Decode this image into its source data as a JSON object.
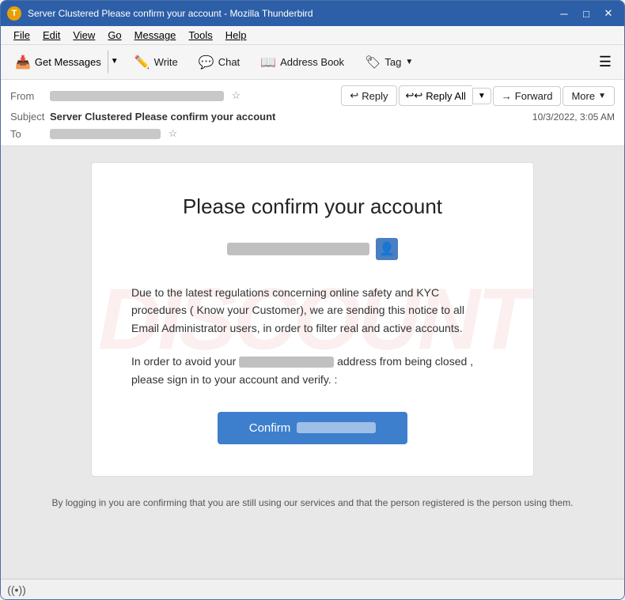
{
  "window": {
    "title": "Server Clustered Please confirm your account - Mozilla Thunderbird",
    "icon": "T"
  },
  "titlebar": {
    "minimize": "─",
    "maximize": "□",
    "close": "✕"
  },
  "menubar": {
    "items": [
      "File",
      "Edit",
      "View",
      "Go",
      "Message",
      "Tools",
      "Help"
    ]
  },
  "toolbar": {
    "get_messages": "Get Messages",
    "write": "Write",
    "chat": "Chat",
    "address_book": "Address Book",
    "tag": "Tag"
  },
  "email_header": {
    "from_label": "From",
    "subject_label": "Subject",
    "to_label": "To",
    "subject_text": "Server Clustered Please confirm your account",
    "date": "10/3/2022, 3:05 AM",
    "reply_label": "Reply",
    "reply_all_label": "Reply All",
    "forward_label": "Forward",
    "more_label": "More"
  },
  "email_body": {
    "title": "Please confirm your account",
    "paragraph1": "Due to the latest regulations concerning online safety and KYC procedures ( Know your Customer), we are sending this notice to all Email Administrator users, in order to filter real and active accounts.",
    "paragraph2_prefix": "In order to avoid your",
    "paragraph2_suffix": "address from being closed  , please sign in to your account and verify. :",
    "confirm_btn": "Confirm",
    "footer": "By logging in you are confirming that you are still using our services and that the person registered is the person using them.",
    "watermark": "DISCOUNT"
  },
  "statusbar": {
    "wifi_symbol": "((•))"
  }
}
